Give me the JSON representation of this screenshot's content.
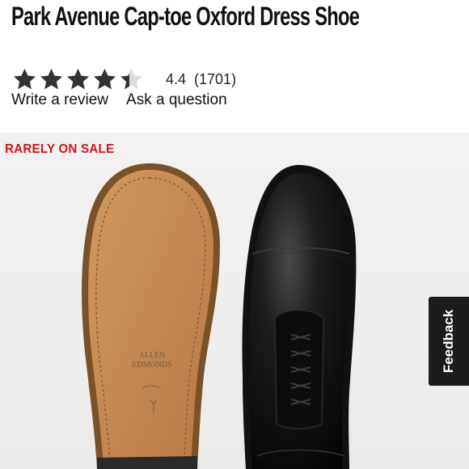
{
  "product": {
    "title": "Park Avenue Cap-toe Oxford Dress Shoe"
  },
  "rating": {
    "value": "4.4",
    "count": "(1701)",
    "stars_filled": 4.4,
    "stars_total": 5,
    "star_color": "#333333",
    "star_empty_color": "#dddddd"
  },
  "links": {
    "write_review": "Write a review",
    "ask_question": "Ask a question"
  },
  "hero": {
    "badge": "RARELY ON SALE",
    "badge_color": "#d7141c",
    "sole_stamp_line1": "ALLEN",
    "sole_stamp_line2": "EDMONDS"
  },
  "feedback": {
    "label": "Feedback"
  }
}
